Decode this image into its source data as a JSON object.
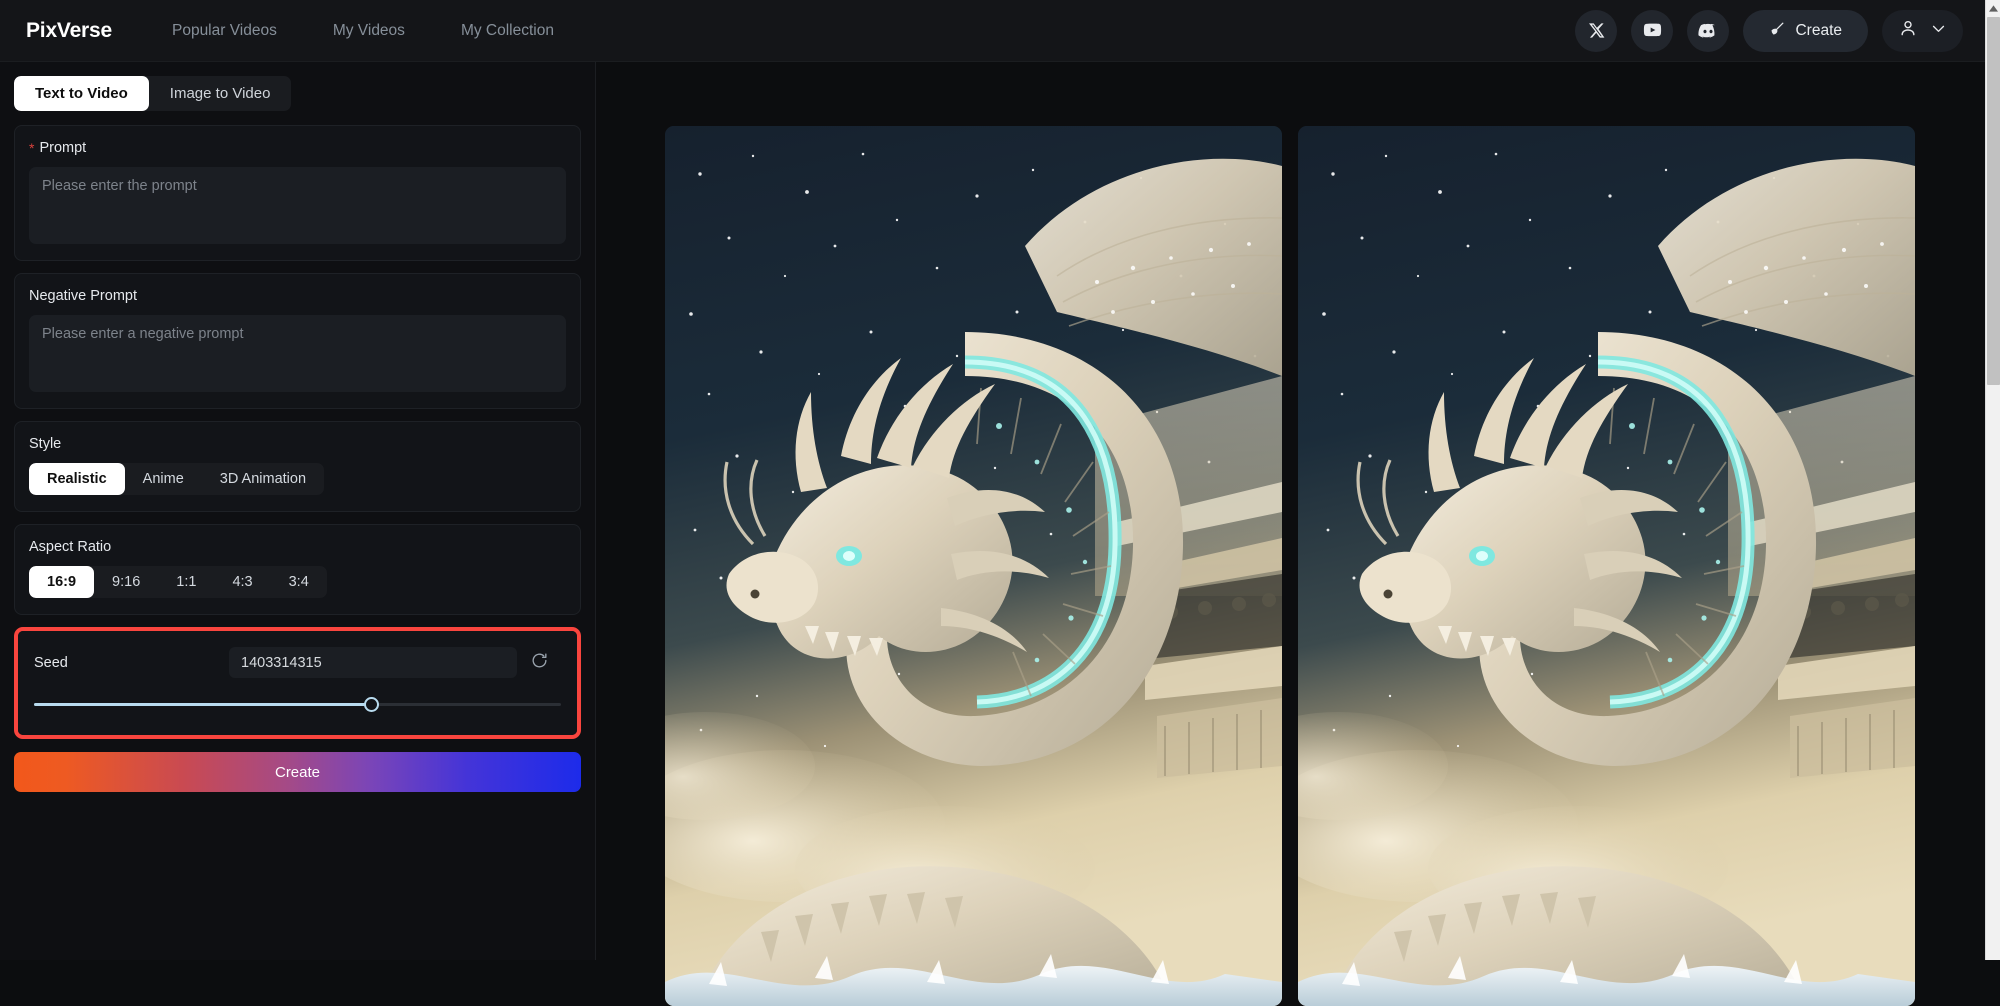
{
  "header": {
    "logo": "PixVerse",
    "nav": [
      {
        "label": "Popular Videos"
      },
      {
        "label": "My Videos"
      },
      {
        "label": "My Collection"
      }
    ],
    "social": [
      {
        "name": "x-twitter-icon"
      },
      {
        "name": "youtube-icon"
      },
      {
        "name": "discord-icon"
      }
    ],
    "create_button": "Create",
    "create_icon": "brush-icon",
    "user_icon": "user-avatar-icon",
    "user_chevron_icon": "chevron-down-icon"
  },
  "tabs": [
    {
      "label": "Text to Video",
      "active": true
    },
    {
      "label": "Image to Video",
      "active": false
    }
  ],
  "prompt": {
    "label": "Prompt",
    "required_marker": "*",
    "placeholder": "Please enter the prompt",
    "value": ""
  },
  "negative_prompt": {
    "label": "Negative Prompt",
    "placeholder": "Please enter a negative prompt",
    "value": ""
  },
  "style": {
    "label": "Style",
    "options": [
      {
        "label": "Realistic",
        "active": true
      },
      {
        "label": "Anime",
        "active": false
      },
      {
        "label": "3D Animation",
        "active": false
      }
    ],
    "selected": "Realistic"
  },
  "aspect_ratio": {
    "label": "Aspect Ratio",
    "options": [
      {
        "label": "16:9",
        "active": true
      },
      {
        "label": "9:16",
        "active": false
      },
      {
        "label": "1:1",
        "active": false
      },
      {
        "label": "4:3",
        "active": false
      },
      {
        "label": "3:4",
        "active": false
      }
    ],
    "selected": "16:9"
  },
  "seed": {
    "label": "Seed",
    "value": "1403314315",
    "refresh_icon": "refresh-icon",
    "slider_percent": 64,
    "highlighted": true,
    "highlight_color": "#f9453e"
  },
  "create_action": {
    "label": "Create"
  },
  "results": {
    "videos": [
      {
        "name": "video-result-1",
        "description": "White ornate dragon with glowing cyan scales coiling before a pagoda under a starry night sky"
      },
      {
        "name": "video-result-2",
        "description": "White ornate dragon with glowing cyan scales coiling before a pagoda under a starry night sky"
      }
    ]
  },
  "scrollbar": {
    "up_arrow_icon": "scroll-up-arrow-icon",
    "thumb": "scroll-thumb"
  },
  "colors": {
    "accent_red": "#f9453e",
    "page_bg": "#0c0d0f",
    "panel_bg": "#0e0f12",
    "card_bg": "#121418",
    "slider_fill": "#b8dbee"
  }
}
